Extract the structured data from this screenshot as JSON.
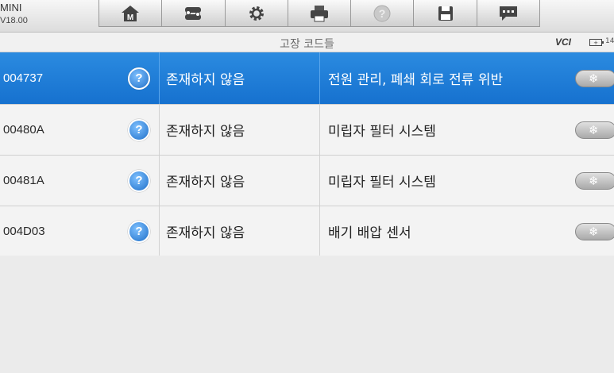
{
  "device": {
    "name": "MINI",
    "version": "V18.00"
  },
  "toolbar": {
    "buttons": [
      {
        "icon": "home-icon",
        "label": "M"
      },
      {
        "icon": "vehicle-swap-icon"
      },
      {
        "icon": "settings-gear-icon"
      },
      {
        "icon": "print-icon"
      },
      {
        "icon": "help-icon"
      },
      {
        "icon": "save-icon"
      },
      {
        "icon": "message-icon"
      }
    ]
  },
  "titlebar": {
    "title": "고장 코드들",
    "vci_label": "VCI",
    "battery_text": "14"
  },
  "fault_table": {
    "rows": [
      {
        "code": "004737",
        "help": "?",
        "status": "존재하지 않음",
        "description": "전원 관리, 폐쇄 회로 전류 위반",
        "freeze_icon": "❄",
        "selected": true
      },
      {
        "code": "00480A",
        "help": "?",
        "status": "존재하지 않음",
        "description": "미립자 필터 시스템",
        "freeze_icon": "❄",
        "selected": false
      },
      {
        "code": "00481A",
        "help": "?",
        "status": "존재하지 않음",
        "description": "미립자 필터 시스템",
        "freeze_icon": "❄",
        "selected": false
      },
      {
        "code": "004D03",
        "help": "?",
        "status": "존재하지 않음",
        "description": "배기 배압 센서",
        "freeze_icon": "❄",
        "selected": false
      }
    ]
  },
  "colors": {
    "selected_row": "#1f7fdc",
    "accent": "#2b8be0"
  }
}
